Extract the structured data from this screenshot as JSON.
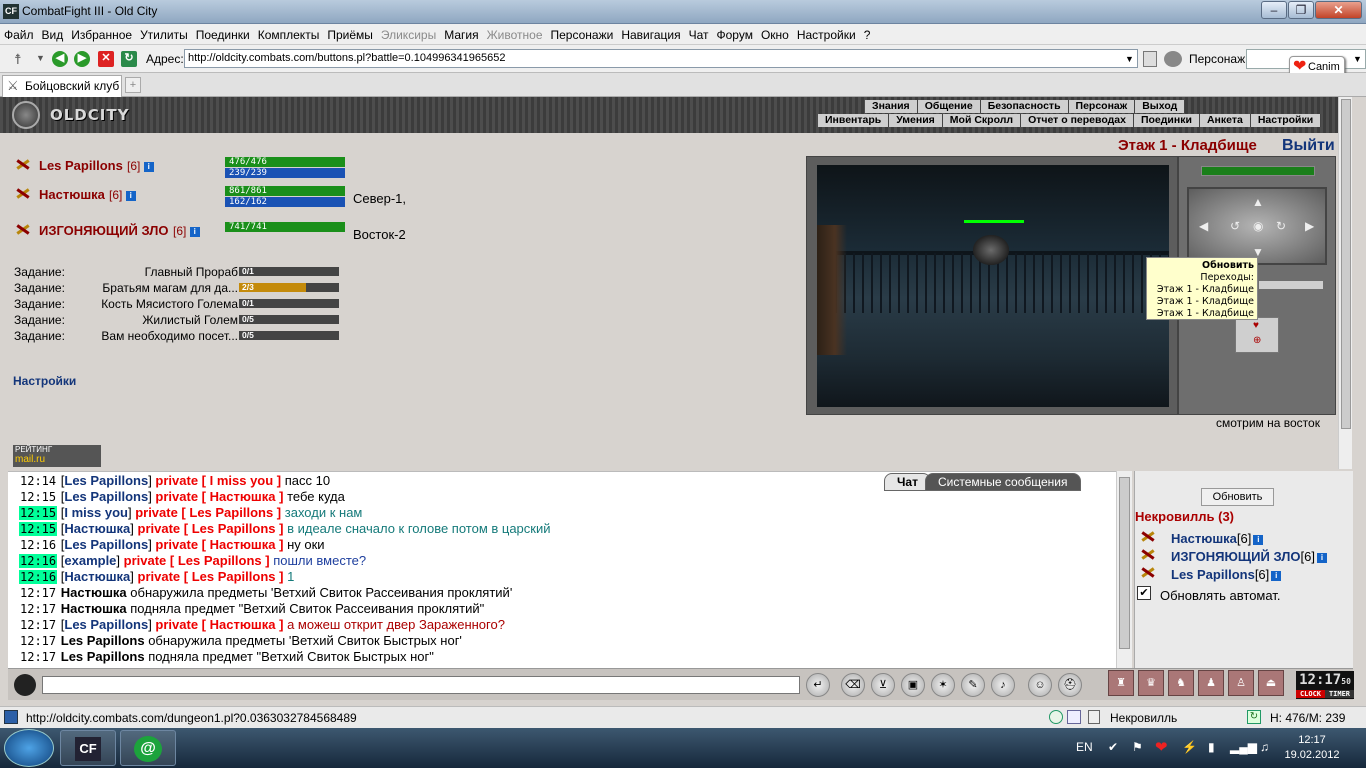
{
  "window": {
    "app_icon": "CF",
    "title": "CombatFight III - Old City"
  },
  "menu": [
    "Файл",
    "Вид",
    "Избранное",
    "Утилиты",
    "Поединки",
    "Комплекты",
    "Приёмы",
    "Эликсиры",
    "Магия",
    "Животное",
    "Персонажи",
    "Навигация",
    "Чат",
    "Форум",
    "Окно",
    "Настройки",
    "?"
  ],
  "menu_disabled": [
    7,
    9
  ],
  "address": {
    "label": "Адрес:",
    "url": "http://oldcity.combats.com/buttons.pl?battle=0.104996341965652",
    "char_label": "Персонаж:",
    "canim": "Canim"
  },
  "tab": {
    "label": "Бойцовский клуб"
  },
  "header": {
    "logo": "OLDCITY",
    "nav1": [
      "Знания",
      "Общение",
      "Безопасность",
      "Персонаж",
      "Выход"
    ],
    "nav2": [
      "Инвентарь",
      "Умения",
      "Мой Скролл",
      "Отчет о переводах",
      "Поединки",
      "Анкета",
      "Настройки"
    ]
  },
  "players": [
    {
      "name": "Les Papillons",
      "level": "[6]",
      "hp": "476/476",
      "mp": "239/239",
      "dir": ""
    },
    {
      "name": "Настюшка",
      "level": "[6]",
      "hp": "861/861",
      "mp": "162/162",
      "dir": "Север-1,"
    },
    {
      "name": "ИЗГОНЯЮЩИЙ ЗЛО",
      "level": "[6]",
      "hp": "741/741",
      "mp": "",
      "dir": "Восток-2"
    }
  ],
  "tasks": [
    {
      "label": "Задание:",
      "name": "Главный Прораб",
      "progress": "0/1",
      "fill": 0
    },
    {
      "label": "Задание:",
      "name": "Братьям магам для да...",
      "progress": "2/3",
      "fill": 0.67
    },
    {
      "label": "Задание:",
      "name": "Кость Мясистого Голема",
      "progress": "0/1",
      "fill": 0
    },
    {
      "label": "Задание:",
      "name": "Жилистый Голем",
      "progress": "0/5",
      "fill": 0
    },
    {
      "label": "Задание:",
      "name": "Вам необходимо посет...",
      "progress": "0/5",
      "fill": 0
    }
  ],
  "settings_link": "Настройки",
  "rating": {
    "line1": "РЕЙТИНГ",
    "line2": "mail.ru"
  },
  "room": {
    "title": "Этаж 1 - Кладбище",
    "exit": "Выйти",
    "caption": "смотрим на восток"
  },
  "tooltip": {
    "title": "Обновить",
    "subtitle": "Переходы:",
    "items": [
      "Этаж 1 - Кладбище",
      "Этаж 1 - Кладбище",
      "Этаж 1 - Кладбище"
    ]
  },
  "chat_tabs": {
    "chat": "Чат",
    "system": "Системные сообщения"
  },
  "chat": [
    {
      "t": "12:14",
      "hl": false,
      "from": "Les Papillons",
      "to": "I miss you",
      "text": "пасс 10",
      "cls": ""
    },
    {
      "t": "12:15",
      "hl": false,
      "from": "Les Papillons",
      "to": "Настюшка",
      "text": "тебе куда",
      "cls": ""
    },
    {
      "t": "12:15",
      "hl": true,
      "from": "I miss you",
      "to": "Les Papillons",
      "text": "заходи к нам",
      "cls": "msg-cyan"
    },
    {
      "t": "12:15",
      "hl": true,
      "from": "Настюшка",
      "to": "Les Papillons",
      "text": "в идеале сначало к голове потом в царский",
      "cls": "msg-cyan"
    },
    {
      "t": "12:16",
      "hl": false,
      "from": "Les Papillons",
      "to": "Настюшка",
      "text": "ну оки",
      "cls": ""
    },
    {
      "t": "12:16",
      "hl": true,
      "from": "example",
      "to": "Les Papillons",
      "text": "пошли вместе?",
      "cls": "msg-blue"
    },
    {
      "t": "12:16",
      "hl": true,
      "from": "Настюшка",
      "to": "Les Papillons",
      "text": "1",
      "cls": "msg-cyan"
    },
    {
      "t": "12:17",
      "hl": false,
      "sys": true,
      "who": "Настюшка",
      "text": "обнаружила предметы 'Ветхий Свиток Рассеивания проклятий'"
    },
    {
      "t": "12:17",
      "hl": false,
      "sys": true,
      "who": "Настюшка",
      "text": "подняла предмет \"Ветхий Свиток Рассеивания проклятий\""
    },
    {
      "t": "12:17",
      "hl": false,
      "from": "Les Papillons",
      "to": "Настюшка",
      "text": "а можеш открит двер Зараженного?",
      "cls": "msg-red"
    },
    {
      "t": "12:17",
      "hl": false,
      "sys": true,
      "who": "Les Papillons",
      "text": "обнаружила предметы 'Ветхий Свиток Быстрых ног'"
    },
    {
      "t": "12:17",
      "hl": false,
      "sys": true,
      "who": "Les Papillons",
      "text": "подняла предмет \"Ветхий Свиток Быстрых ног\""
    }
  ],
  "right_panel": {
    "refresh": "Обновить",
    "location": "Некровилль (3)",
    "players": [
      {
        "name": "Настюшка",
        "level": "[6]"
      },
      {
        "name": "ИЗГОНЯЮЩИЙ ЗЛО",
        "level": "[6]"
      },
      {
        "name": "Les Papillons",
        "level": "[6]"
      }
    ],
    "auto_label": "Обновлять автомат."
  },
  "clock": {
    "time": "12:17",
    "sec": "50",
    "clock": "CLOCK",
    "timer": "TIMER"
  },
  "statusbar": {
    "url": "http://oldcity.combats.com/dungeon1.pl?0.0363032784568489",
    "location": "Некровилль",
    "stats": "H: 476/M: 239"
  },
  "taskbar": {
    "lang": "EN",
    "time": "12:17",
    "date": "19.02.2012"
  }
}
